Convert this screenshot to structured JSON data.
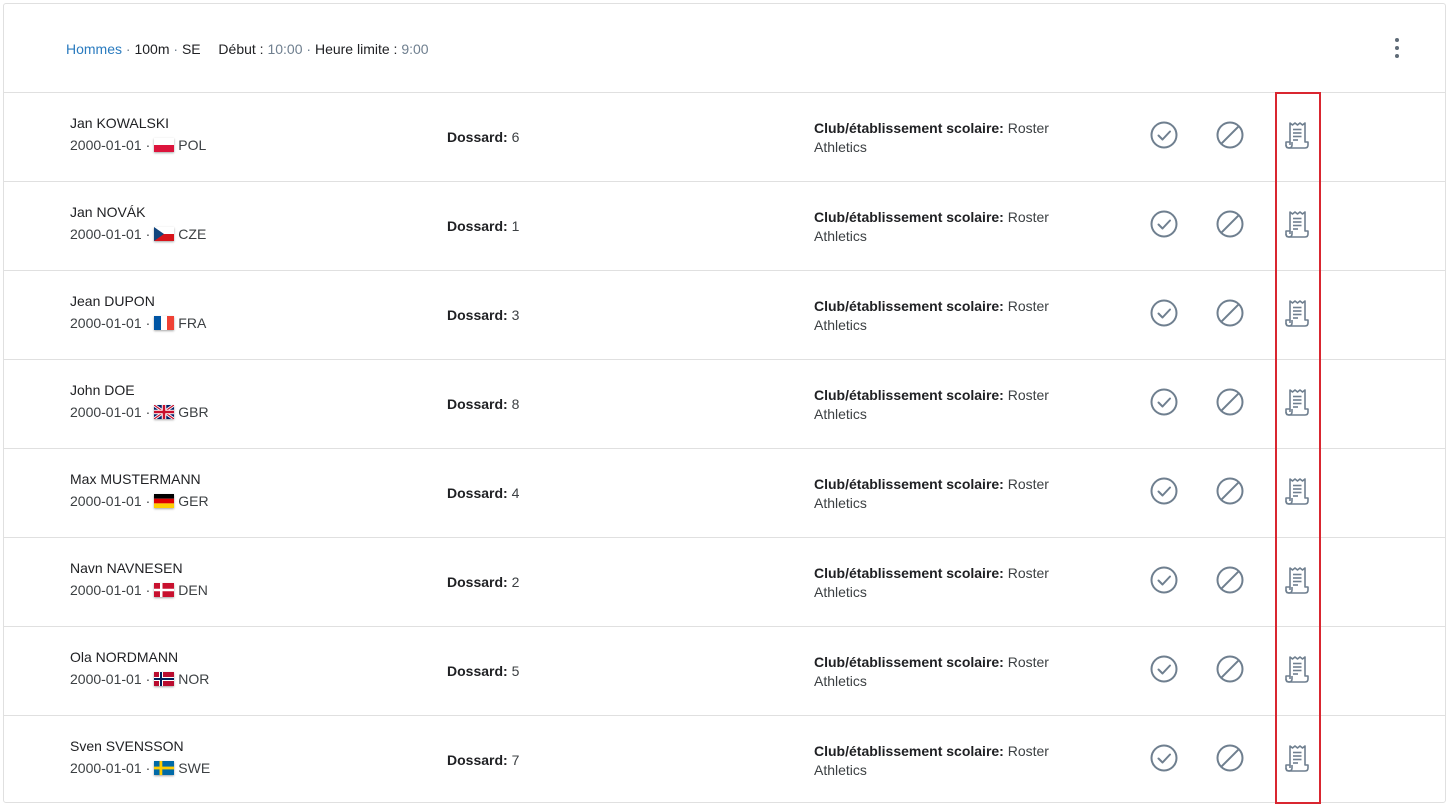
{
  "header": {
    "category": "Hommes",
    "sep1": " · ",
    "event": "100m",
    "sep2": " · ",
    "age_group": "SE",
    "start_label": "Début",
    "colon1": " : ",
    "start_time": "10:00",
    "sep3": " · ",
    "deadline_label": "Heure limite",
    "colon2": " : ",
    "deadline_time": "9:00",
    "more_icon": "more-vertical-icon"
  },
  "labels": {
    "bib": "Dossard:",
    "club": "Club/établissement scolaire:"
  },
  "colors": {
    "accent": "#2a7bbf",
    "icon": "#6f7f8f",
    "highlight": "#d92630"
  },
  "athletes": [
    {
      "name": "Jan KOWALSKI",
      "dob": "2000-01-01",
      "country": "POL",
      "flag": "pol",
      "bib": "6",
      "club": "Roster Athletics"
    },
    {
      "name": "Jan NOVÁK",
      "dob": "2000-01-01",
      "country": "CZE",
      "flag": "cze",
      "bib": "1",
      "club": "Roster Athletics"
    },
    {
      "name": "Jean DUPON",
      "dob": "2000-01-01",
      "country": "FRA",
      "flag": "fra",
      "bib": "3",
      "club": "Roster Athletics"
    },
    {
      "name": "John DOE",
      "dob": "2000-01-01",
      "country": "GBR",
      "flag": "gbr",
      "bib": "8",
      "club": "Roster Athletics"
    },
    {
      "name": "Max MUSTERMANN",
      "dob": "2000-01-01",
      "country": "GER",
      "flag": "ger",
      "bib": "4",
      "club": "Roster Athletics"
    },
    {
      "name": "Navn NAVNESEN",
      "dob": "2000-01-01",
      "country": "DEN",
      "flag": "den",
      "bib": "2",
      "club": "Roster Athletics"
    },
    {
      "name": "Ola NORDMANN",
      "dob": "2000-01-01",
      "country": "NOR",
      "flag": "nor",
      "bib": "5",
      "club": "Roster Athletics"
    },
    {
      "name": "Sven SVENSSON",
      "dob": "2000-01-01",
      "country": "SWE",
      "flag": "swe",
      "bib": "7",
      "club": "Roster Athletics"
    }
  ],
  "row_icons": [
    "check-circle-icon",
    "block-icon",
    "receipt-icon"
  ]
}
